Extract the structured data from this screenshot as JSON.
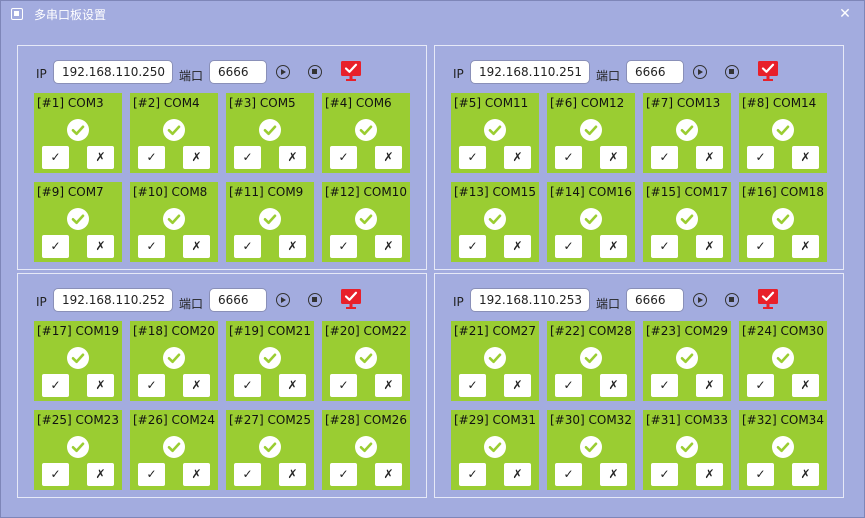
{
  "window": {
    "title": "多串口板设置",
    "close_glyph": "✕"
  },
  "labels": {
    "ip": "IP",
    "port": "端口",
    "ok": "✓",
    "cancel": "✗"
  },
  "colors": {
    "card": "#9acd32",
    "monitor": "#e8202a",
    "background": "#a3acdf"
  },
  "panels": [
    {
      "ip": "192.168.110.250",
      "port": "6666",
      "cards": [
        "[#1] COM3",
        "[#2] COM4",
        "[#3] COM5",
        "[#4] COM6",
        "[#9] COM7",
        "[#10] COM8",
        "[#11] COM9",
        "[#12] COM10"
      ]
    },
    {
      "ip": "192.168.110.251",
      "port": "6666",
      "cards": [
        "[#5] COM11",
        "[#6] COM12",
        "[#7] COM13",
        "[#8] COM14",
        "[#13] COM15",
        "[#14] COM16",
        "[#15] COM17",
        "[#16] COM18"
      ]
    },
    {
      "ip": "192.168.110.252",
      "port": "6666",
      "cards": [
        "[#17] COM19",
        "[#18] COM20",
        "[#19] COM21",
        "[#20] COM22",
        "[#25] COM23",
        "[#26] COM24",
        "[#27] COM25",
        "[#28] COM26"
      ]
    },
    {
      "ip": "192.168.110.253",
      "port": "6666",
      "cards": [
        "[#21] COM27",
        "[#22] COM28",
        "[#23] COM29",
        "[#24] COM30",
        "[#29] COM31",
        "[#30] COM32",
        "[#31] COM33",
        "[#32] COM34"
      ]
    }
  ],
  "icons": {
    "app": "app-icon",
    "play": "play-icon",
    "stop": "stop-icon",
    "monitor": "monitor-check-icon",
    "status": "check-circle-icon"
  }
}
